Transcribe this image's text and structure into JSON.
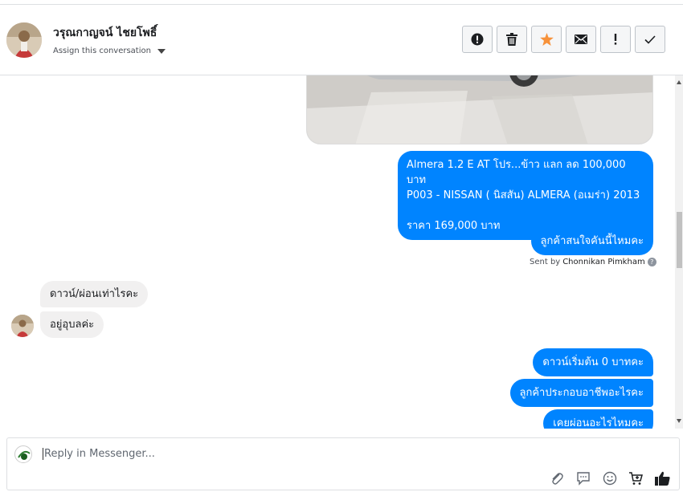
{
  "header": {
    "contact_name": "วรุณกาญจน์ ไชยโพธิ์",
    "assign_label": "Assign this conversation",
    "actions": [
      {
        "icon": "alert-circle-icon"
      },
      {
        "icon": "trash-icon"
      },
      {
        "icon": "star-icon",
        "color": "#f7923b"
      },
      {
        "icon": "envelope-icon"
      },
      {
        "icon": "exclamation-icon"
      },
      {
        "icon": "check-icon"
      }
    ]
  },
  "messages": {
    "card_line1": "Almera 1.2 E AT โปร...ข้าว แลก ลด 100,000 บาท",
    "card_line2": "P003 - NISSAN ( นิสสัน) ALMERA (อเมร่า) 2013",
    "card_line3": "ราคา 169,000 บาท",
    "out_1": "ลูกค้าสนใจคันนี้ไหมคะ",
    "sent_by_prefix": "Sent by",
    "sent_by_name": "Chonnikan Pimkham",
    "in_1": "ดาวน์/ผ่อนเท่าไรคะ",
    "in_2": "อยู่อุบลค่ะ",
    "out_2": "ดาวน์เริ่มต้น 0 บาทคะ",
    "out_3": "ลูกค้าประกอบอาชีพอะไรคะ",
    "out_4": "เคยผ่อนอะไรไหมคะ"
  },
  "composer": {
    "placeholder": "Reply in Messenger...",
    "tools": [
      "paperclip-icon",
      "saved-reply-icon",
      "emoji-icon",
      "cart-icon",
      "thumbs-up-icon"
    ]
  },
  "colors": {
    "outgoing_bubble": "#0084ff",
    "incoming_bubble": "#f1f0f0",
    "star": "#f7923b"
  }
}
